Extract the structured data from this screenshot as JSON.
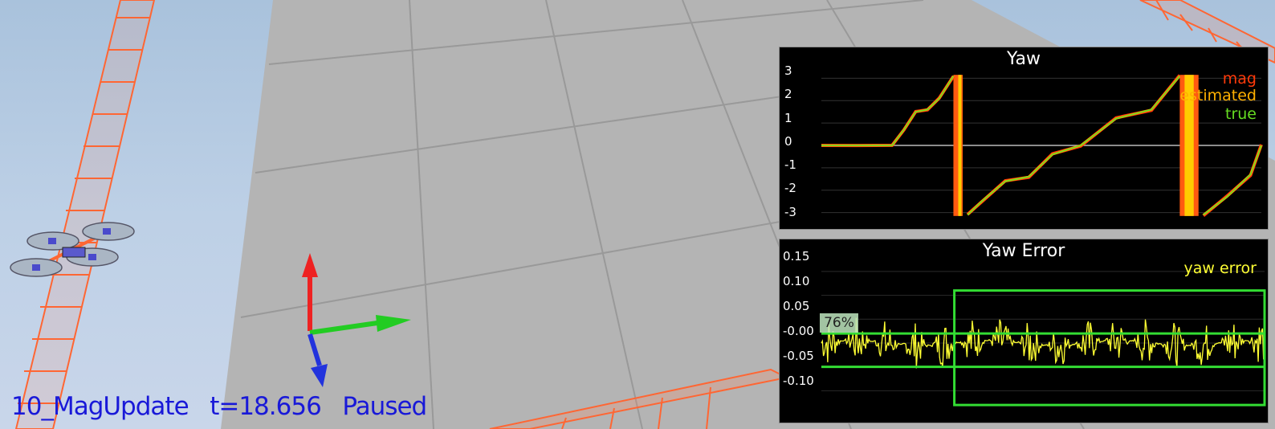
{
  "scenario_name": "10_MagUpdate",
  "time_label": "t=18.656",
  "status": "Paused",
  "yaw_chart": {
    "title": "Yaw",
    "y_ticks": [
      "3",
      "2",
      "1",
      "0",
      "-1",
      "-2",
      "-3"
    ],
    "legend": [
      {
        "label": "mag",
        "color": "#ff3a0a"
      },
      {
        "label": "estimated",
        "color": "#ffb000"
      },
      {
        "label": "true",
        "color": "#66dd22"
      }
    ]
  },
  "yaw_error_chart": {
    "title": "Yaw Error",
    "y_ticks": [
      "0.15",
      "0.10",
      "0.05",
      "-0.00",
      "-0.05",
      "-0.10"
    ],
    "legend": [
      {
        "label": "yaw error",
        "color": "#ffff33"
      }
    ],
    "percent_badge": "76%",
    "threshold_color": "#33dd33"
  },
  "colors": {
    "sky_top": "#a9c2dc",
    "ground": "#b4b4b4",
    "rail": "#ff6633",
    "axis_x": "#22cc22",
    "axis_y": "#ee2222",
    "axis_z": "#2233dd",
    "status_text": "#1919d8"
  },
  "scene_icons": [
    "quadcopter-icon",
    "xyz-axes-icon"
  ],
  "chart_data": [
    {
      "type": "line",
      "title": "Yaw",
      "xlabel": "",
      "ylabel": "",
      "ylim": [
        -3.3,
        3.3
      ],
      "y_ticks": [
        3,
        2,
        1,
        0,
        -1,
        -2,
        -3
      ],
      "x": [
        0,
        1.5,
        3,
        3.5,
        4,
        4.5,
        5,
        5.6,
        6.2,
        6.8,
        7.8,
        8.8,
        9.8,
        11,
        12.5,
        14,
        15.2,
        16.2,
        17.2,
        18.2,
        18.66
      ],
      "series": [
        {
          "name": "mag",
          "values": [
            0,
            0,
            0,
            0.7,
            1.5,
            1.6,
            2.1,
            3.1,
            -3.1,
            -2.5,
            -1.6,
            -1.4,
            -0.4,
            0,
            1.2,
            1.6,
            3.1,
            -3.1,
            -2.3,
            -1.3,
            0
          ]
        },
        {
          "name": "estimated",
          "values": [
            0,
            0,
            0,
            0.7,
            1.5,
            1.6,
            2.1,
            3.1,
            -3.1,
            -2.5,
            -1.6,
            -1.4,
            -0.4,
            0,
            1.2,
            1.6,
            3.1,
            -3.1,
            -2.3,
            -1.3,
            0
          ]
        },
        {
          "name": "true",
          "values": [
            0,
            0,
            0,
            0.7,
            1.5,
            1.6,
            2.1,
            3.1,
            -3.1,
            -2.5,
            -1.6,
            -1.4,
            -0.4,
            0,
            1.2,
            1.6,
            3.1,
            -3.1,
            -2.3,
            -1.3,
            0
          ]
        }
      ]
    },
    {
      "type": "line",
      "title": "Yaw Error",
      "xlabel": "",
      "ylabel": "",
      "ylim": [
        -0.15,
        0.17
      ],
      "y_ticks": [
        0.15,
        0.1,
        0.05,
        -0.0,
        -0.05,
        -0.1
      ],
      "series": [
        {
          "name": "yaw error",
          "amplitude": 0.05
        }
      ],
      "thresholds": [
        0.02,
        -0.05
      ],
      "box_ylim": [
        -0.13,
        0.11
      ],
      "box_start_fraction": 0.3,
      "badge": "76%"
    }
  ]
}
